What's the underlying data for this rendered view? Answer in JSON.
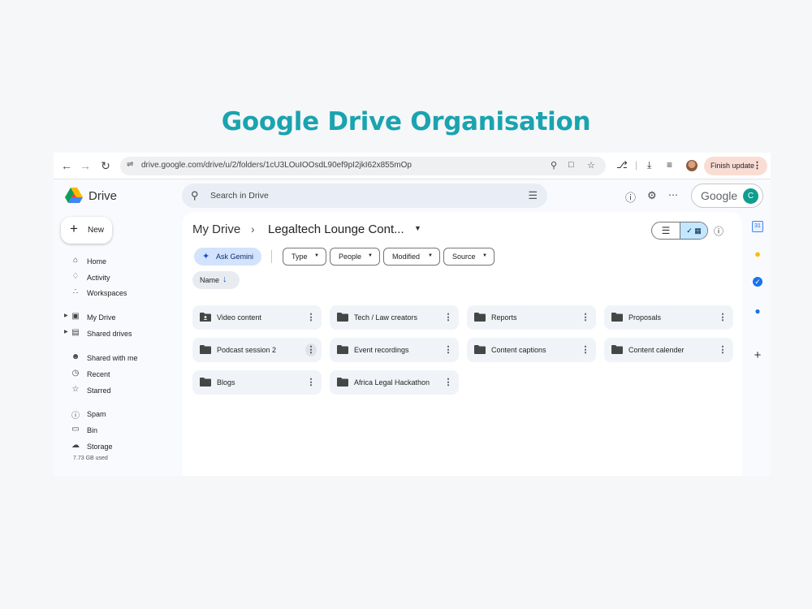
{
  "headline": "Google Drive Organisation",
  "browser": {
    "url": "drive.google.com/drive/u/2/folders/1cU3LOuIOOsdL90ef9pI2jkI62x855mOp",
    "update_label": "Finish update",
    "icons": [
      "back-icon",
      "forward-icon",
      "reload-icon",
      "site-settings-icon",
      "zoom-icon",
      "install-app-icon",
      "bookmark-star-icon",
      "extensions-icon",
      "downloads-icon",
      "reading-list-icon",
      "profile-icon",
      "menu-icon"
    ]
  },
  "header": {
    "brand": "Drive",
    "search_placeholder": "Search in Drive",
    "google_label": "Google",
    "avatar_letter": "C"
  },
  "sidebar": {
    "new_label": "New",
    "items": [
      {
        "label": "Home",
        "icon": "home-icon"
      },
      {
        "label": "Activity",
        "icon": "bell-icon"
      },
      {
        "label": "Workspaces",
        "icon": "workspaces-icon"
      },
      {
        "label": "My Drive",
        "icon": "my-drive-icon"
      },
      {
        "label": "Shared drives",
        "icon": "shared-drives-icon"
      },
      {
        "label": "Shared with me",
        "icon": "shared-with-me-icon"
      },
      {
        "label": "Recent",
        "icon": "clock-icon"
      },
      {
        "label": "Starred",
        "icon": "star-icon"
      },
      {
        "label": "Spam",
        "icon": "spam-icon"
      },
      {
        "label": "Bin",
        "icon": "bin-icon"
      },
      {
        "label": "Storage",
        "icon": "cloud-icon"
      }
    ],
    "storage_used": "7.73 GB used"
  },
  "main": {
    "breadcrumb_root": "My Drive",
    "breadcrumb_current": "Legaltech Lounge Cont...",
    "ask_gemini": "Ask Gemini",
    "filters": [
      "Type",
      "People",
      "Modified",
      "Source"
    ],
    "sort_label": "Name",
    "folders": [
      "Video content",
      "Tech / Law creators",
      "Reports",
      "Proposals",
      "Podcast session 2",
      "Event recordings",
      "Content captions",
      "Content calender",
      "Blogs",
      "Africa Legal Hackathon"
    ]
  },
  "rail": {
    "calendar_day": "31",
    "icons": [
      "calendar-icon",
      "keep-icon",
      "tasks-icon",
      "contacts-icon",
      "add-addon-icon"
    ]
  },
  "colors": {
    "headline": "#1aa3b0",
    "accent": "#0b57d0",
    "gemini_chip": "#d3e3fd",
    "folder_card": "#f0f4f9"
  }
}
